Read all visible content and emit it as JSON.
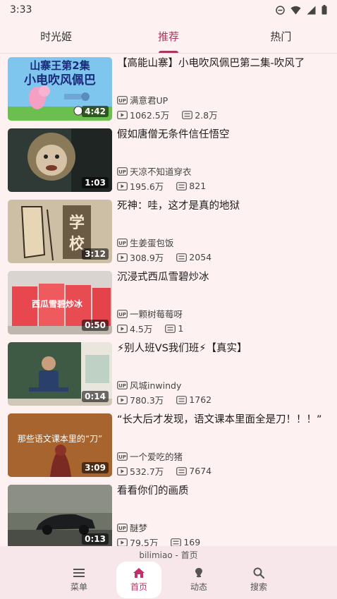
{
  "status_bar": {
    "time": "3:33"
  },
  "tabs": [
    {
      "label": "时光姬"
    },
    {
      "label": "推荐"
    },
    {
      "label": "热门"
    }
  ],
  "videos": [
    {
      "title": "【高能山寨】小电吹风佩巴第二集-吹风了",
      "duration": "4:42",
      "up_name": "满意君UP",
      "views": "1062.5万",
      "danmaku": "2.8万",
      "thumb_text": [
        "山寨王第2集",
        "小电吹风佩巴"
      ]
    },
    {
      "title": "假如唐僧无条件信任悟空",
      "duration": "1:03",
      "up_name": "天凉不知道穿衣",
      "views": "195.6万",
      "danmaku": "821"
    },
    {
      "title": "死神：哇，这才是真的地狱",
      "duration": "3:12",
      "up_name": "生姜蛋包饭",
      "views": "308.9万",
      "danmaku": "2054",
      "thumb_text": [
        "学",
        "校"
      ]
    },
    {
      "title": "沉浸式西瓜雪碧炒冰",
      "duration": "0:50",
      "up_name": "一颗树莓莓呀",
      "views": "4.5万",
      "danmaku": "1",
      "thumb_text": [
        "西瓜雪碧炒冰"
      ]
    },
    {
      "title": "⚡别人班VS我们班⚡【真实】",
      "duration": "0:14",
      "up_name": "风城inwindy",
      "views": "780.3万",
      "danmaku": "1762"
    },
    {
      "title": "“长大后才发现，语文课本里面全是刀！！！”",
      "duration": "3:09",
      "up_name": "一个爱吃的猪",
      "views": "532.7万",
      "danmaku": "7674",
      "thumb_text": [
        "那些语文课本里的“刀”"
      ]
    },
    {
      "title": "看看你们的画质",
      "duration": "0:13",
      "up_name": "醚梦",
      "views": "79.5万",
      "danmaku": "169"
    }
  ],
  "bottom_bar": {
    "label": "bilimiao - 首页",
    "items": [
      {
        "label": "菜单"
      },
      {
        "label": "首页"
      },
      {
        "label": "动态"
      },
      {
        "label": "搜索"
      }
    ]
  }
}
